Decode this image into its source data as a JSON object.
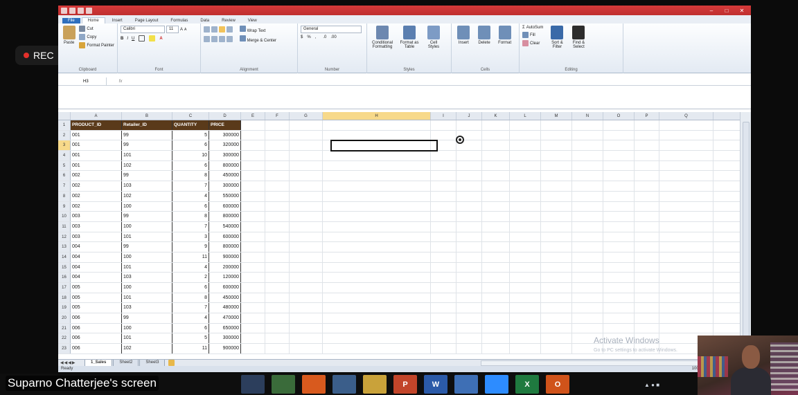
{
  "recording": {
    "label": "REC"
  },
  "share_label": "Suparno Chatterjee's screen",
  "excel": {
    "ribbon_tabs": [
      "File",
      "Home",
      "Insert",
      "Page Layout",
      "Formulas",
      "Data",
      "Review",
      "View"
    ],
    "active_tab": "Home",
    "clipboard": {
      "cut": "Cut",
      "copy": "Copy",
      "paste": "Paste",
      "format_painter": "Format Painter",
      "group": "Clipboard"
    },
    "font": {
      "name": "Calibri",
      "size": "11",
      "group": "Font"
    },
    "alignment": {
      "wrap_text": "Wrap Text",
      "merge_center": "Merge & Center",
      "group": "Alignment"
    },
    "number": {
      "format": "General",
      "group": "Number"
    },
    "styles": {
      "conditional": "Conditional Formatting",
      "format_table": "Format as Table",
      "cell_styles": "Cell Styles",
      "group": "Styles"
    },
    "cells": {
      "insert": "Insert",
      "delete": "Delete",
      "format": "Format",
      "group": "Cells"
    },
    "editing": {
      "autosum": "AutoSum",
      "fill": "Fill",
      "clear": "Clear",
      "sort_filter": "Sort & Filter",
      "find_select": "Find & Select",
      "group": "Editing"
    },
    "name_box": "H3",
    "fx": "fx",
    "columns": [
      "A",
      "B",
      "C",
      "D",
      "E",
      "F",
      "G",
      "H",
      "I",
      "J",
      "K",
      "L",
      "M",
      "N",
      "O",
      "P",
      "Q"
    ],
    "selected_column": "H",
    "selected_row": 3,
    "header_row": [
      "PRODUCT_ID",
      "Retailer_ID",
      "QUANTITY",
      "PRICE"
    ],
    "rows": [
      [
        "001",
        "99",
        "5",
        "300000"
      ],
      [
        "001",
        "99",
        "6",
        "320000"
      ],
      [
        "001",
        "101",
        "10",
        "300000"
      ],
      [
        "001",
        "102",
        "6",
        "800000"
      ],
      [
        "002",
        "99",
        "8",
        "450000"
      ],
      [
        "002",
        "103",
        "7",
        "300000"
      ],
      [
        "002",
        "102",
        "4",
        "550000"
      ],
      [
        "002",
        "100",
        "6",
        "600000"
      ],
      [
        "003",
        "99",
        "8",
        "800000"
      ],
      [
        "003",
        "100",
        "7",
        "540000"
      ],
      [
        "003",
        "101",
        "3",
        "600000"
      ],
      [
        "004",
        "99",
        "9",
        "800000"
      ],
      [
        "004",
        "100",
        "11",
        "900000"
      ],
      [
        "004",
        "101",
        "4",
        "200000"
      ],
      [
        "004",
        "103",
        "2",
        "120000"
      ],
      [
        "005",
        "100",
        "6",
        "600000"
      ],
      [
        "005",
        "101",
        "8",
        "450000"
      ],
      [
        "005",
        "103",
        "7",
        "480000"
      ],
      [
        "006",
        "99",
        "4",
        "470000"
      ],
      [
        "006",
        "100",
        "6",
        "650000"
      ],
      [
        "006",
        "101",
        "5",
        "300000"
      ],
      [
        "006",
        "102",
        "11",
        "900000"
      ]
    ],
    "sheets": [
      "1_Sales",
      "Sheet2",
      "Sheet3"
    ],
    "active_sheet": "1_Sales",
    "status": "Ready",
    "zoom": "100%",
    "watermark_title": "Activate Windows",
    "watermark_sub": "Go to PC settings to activate Windows."
  },
  "taskbar_icons": [
    "explorer-icon",
    "photos-icon",
    "firefox-icon",
    "network-icon",
    "folder-icon",
    "powerpoint-icon",
    "word-icon",
    "app-icon",
    "zoom-icon",
    "excel-icon",
    "outlook-icon"
  ],
  "taskbar_letters": {
    "powerpoint-icon": "P",
    "word-icon": "W",
    "excel-icon": "X",
    "outlook-icon": "O"
  }
}
